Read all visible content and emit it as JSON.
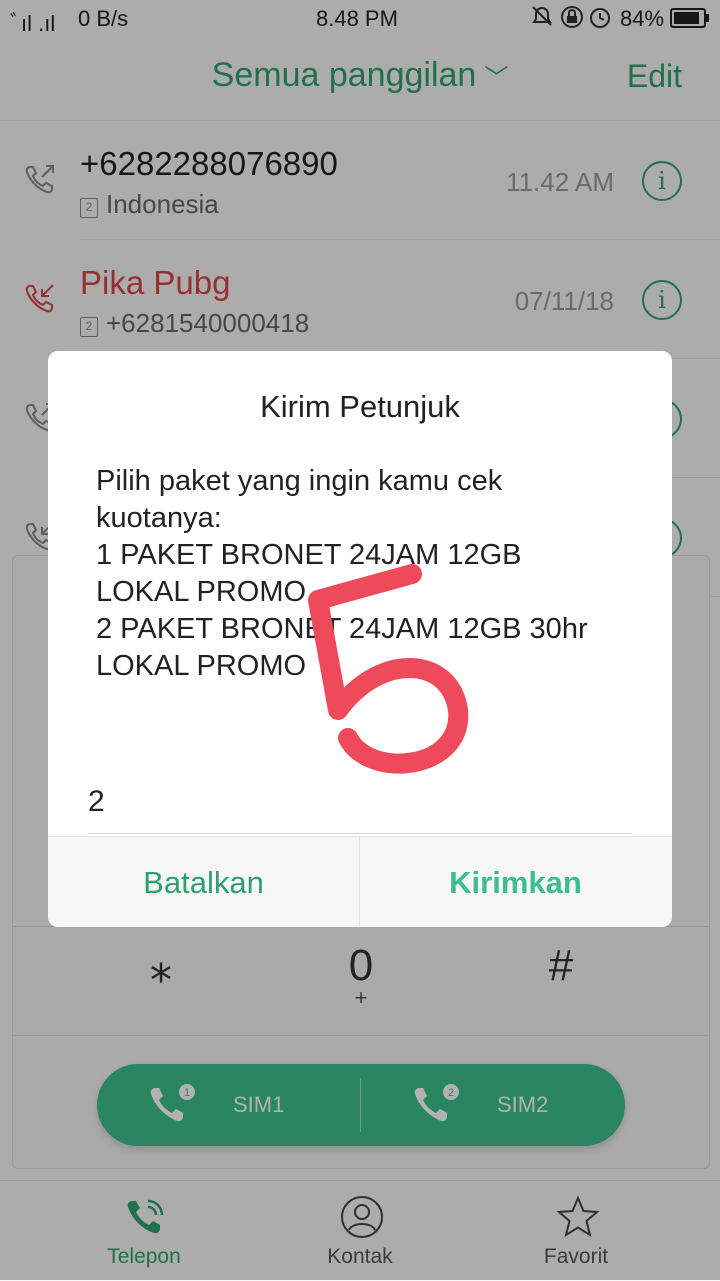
{
  "status_bar": {
    "signal": "ﾞıl .ıl",
    "net_speed": "0 B/s",
    "time": "8.48 PM",
    "battery": "84%"
  },
  "header": {
    "title": "Semua panggilan",
    "edit": "Edit"
  },
  "calls": [
    {
      "name": "+6282288076890",
      "sub": "Indonesia",
      "sim": "2",
      "time": "11.42 AM",
      "type": "outgoing"
    },
    {
      "name": "Pika Pubg",
      "sub": "+6281540000418",
      "sim": "2",
      "time": "07/11/18",
      "type": "missed"
    },
    {
      "type": "outgoing"
    },
    {
      "type": "incoming"
    }
  ],
  "dialpad": {
    "keys": [
      {
        "main": "⁎",
        "sub": ""
      },
      {
        "main": "0",
        "sub": "+"
      },
      {
        "main": "#",
        "sub": ""
      }
    ],
    "sim1": "SIM1",
    "sim2": "SIM2",
    "sim1_badge": "1",
    "sim2_badge": "2"
  },
  "dialog": {
    "title": "Kirim Petunjuk",
    "lines": [
      "Pilih paket yang ingin kamu cek",
      "kuotanya:",
      "1 PAKET BRONET 24JAM 12GB",
      "LOKAL PROMO",
      "2 PAKET BRONET 24JAM 12GB 30hr",
      "LOKAL PROMO"
    ],
    "input_value": "2",
    "cancel": "Batalkan",
    "send": "Kirimkan"
  },
  "annotation": {
    "digit": "5",
    "color": "#ef4a5b"
  },
  "nav": {
    "phone": "Telepon",
    "contacts": "Kontak",
    "favorites": "Favorit"
  },
  "colors": {
    "accent": "#2e9f72",
    "accent_light": "#3cbf8d",
    "missed": "#d94545"
  }
}
